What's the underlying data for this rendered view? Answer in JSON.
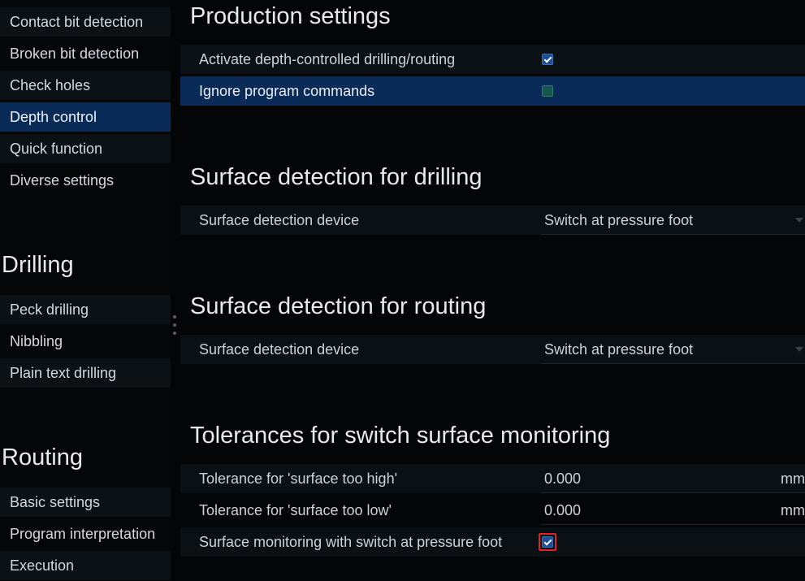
{
  "sidebar": {
    "items_top": [
      {
        "label": "Contact bit detection"
      },
      {
        "label": "Broken bit detection"
      },
      {
        "label": "Check holes"
      },
      {
        "label": "Depth control"
      },
      {
        "label": "Quick function"
      },
      {
        "label": "Diverse settings"
      }
    ],
    "drilling_heading": "Drilling",
    "drilling_items": [
      {
        "label": "Peck drilling"
      },
      {
        "label": "Nibbling"
      },
      {
        "label": "Plain text drilling"
      }
    ],
    "routing_heading": "Routing",
    "routing_items": [
      {
        "label": "Basic settings"
      },
      {
        "label": "Program interpretation"
      },
      {
        "label": "Execution"
      }
    ],
    "selected": "Depth control"
  },
  "production": {
    "title": "Production settings",
    "activate_label": "Activate depth-controlled drilling/routing",
    "activate_checked": true,
    "ignore_label": "Ignore program commands",
    "ignore_checked": false
  },
  "surface_drilling": {
    "title": "Surface detection for drilling",
    "device_label": "Surface detection device",
    "device_value": "Switch at pressure foot"
  },
  "surface_routing": {
    "title": "Surface detection for routing",
    "device_label": "Surface detection device",
    "device_value": "Switch at pressure foot"
  },
  "tolerances": {
    "title": "Tolerances for switch surface monitoring",
    "high_label": "Tolerance for 'surface too high'",
    "high_value": "0.000",
    "high_unit": "mm",
    "low_label": "Tolerance for 'surface too low'",
    "low_value": "0.000",
    "low_unit": "mm",
    "monitoring_label": "Surface monitoring with switch at pressure foot",
    "monitoring_checked": true
  },
  "colors": {
    "selection": "#0a2a57",
    "checkbox_checked": "#1e4f96",
    "focus": "#e0222a"
  }
}
